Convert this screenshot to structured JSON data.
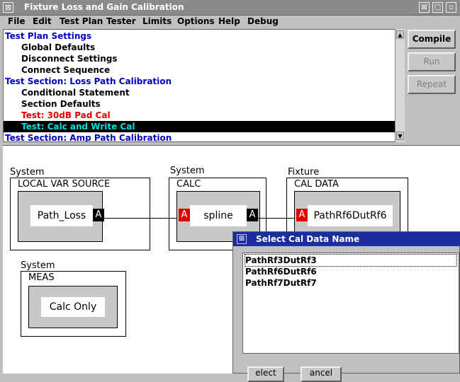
{
  "window": {
    "title": "Fixture Loss and Gain Calibration",
    "controls": [
      "⊠",
      "□",
      "▫"
    ]
  },
  "menu": [
    "File",
    "Edit",
    "Test Plan",
    "Tester",
    "Limits",
    "Options",
    "Help",
    "Debug"
  ],
  "tree": [
    {
      "label": "Test Plan Settings",
      "color": "#0000c0",
      "indent": 0
    },
    {
      "label": "Global Defaults",
      "color": "#000000",
      "indent": 1
    },
    {
      "label": "Disconnect Settings",
      "color": "#000000",
      "indent": 1
    },
    {
      "label": "Connect Sequence",
      "color": "#000000",
      "indent": 1
    },
    {
      "label": "Test Section: Loss Path Calibration",
      "color": "#0000c0",
      "indent": 0
    },
    {
      "label": "Conditional Statement",
      "color": "#000000",
      "indent": 1
    },
    {
      "label": "Section Defaults",
      "color": "#000000",
      "indent": 1
    },
    {
      "label": "Test: 30dB Pad Cal",
      "color": "#e00000",
      "indent": 1
    },
    {
      "label": "Test: Calc and Write Cal",
      "color": "#00e0e0",
      "indent": 1,
      "selected": true
    },
    {
      "label": "Test Section: Amp Path Calibration",
      "color": "#0000c0",
      "indent": 0
    }
  ],
  "buttons": {
    "compile": "Compile",
    "run": "Run",
    "repeat": "Repeat"
  },
  "diagram": {
    "block1": {
      "category": "System",
      "name": "LOCAL VAR SOURCE",
      "inner": "Path_Loss",
      "port_out": "A"
    },
    "block2": {
      "category": "System",
      "name": "CALC",
      "inner": "spline",
      "port_in": "A",
      "port_out": "A"
    },
    "block3": {
      "category": "Fixture",
      "name": "CAL DATA",
      "inner": "PathRf6DutRf6",
      "port_in": "A"
    },
    "block4": {
      "category": "System",
      "name": "MEAS",
      "inner": "Calc Only"
    }
  },
  "dialog": {
    "title": "Select Cal Data Name",
    "items": [
      "PathRf3DutRf3",
      "PathRf6DutRf6",
      "PathRf7DutRf7"
    ],
    "buttons": [
      "elect",
      "ancel"
    ]
  }
}
